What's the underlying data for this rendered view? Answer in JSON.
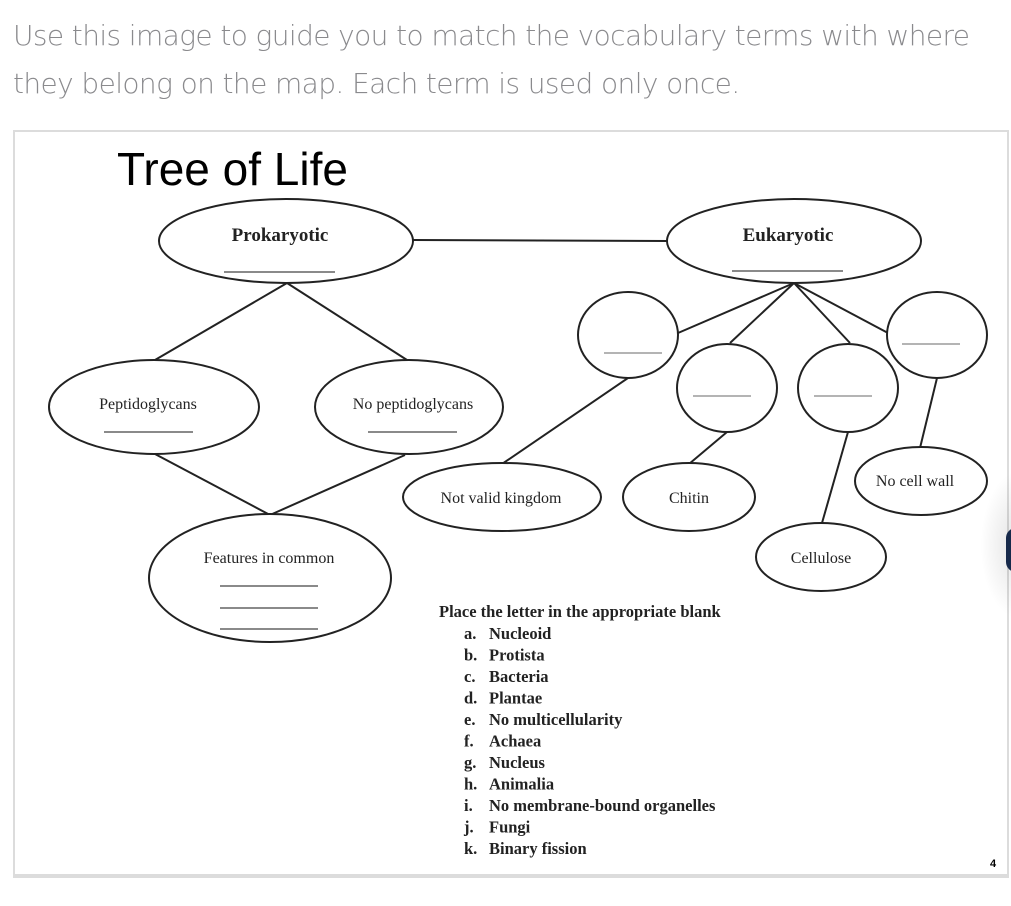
{
  "instructions": "Use this image to guide you to match the vocabulary terms with where they belong on the map. Each term is used only once.",
  "worksheet": {
    "title": "Tree of Life",
    "page_number": "4",
    "nodes": {
      "prokaryotic": {
        "label": "Prokaryotic",
        "blanks": 1
      },
      "eukaryotic": {
        "label": "Eukaryotic",
        "blanks": 1
      },
      "peptidoglycans": {
        "label": "Peptidoglycans",
        "blanks": 1
      },
      "no_peptidoglycans": {
        "label": "No peptidoglycans",
        "blanks": 1
      },
      "features_in_common": {
        "label": "Features in common",
        "blanks": 3
      },
      "eukaryote_kingdom_1": {
        "label": "",
        "blanks": 1
      },
      "eukaryote_kingdom_2": {
        "label": "",
        "blanks": 1
      },
      "eukaryote_kingdom_3": {
        "label": "",
        "blanks": 1
      },
      "eukaryote_kingdom_4": {
        "label": "",
        "blanks": 1
      },
      "not_valid_kingdom": {
        "label": "Not valid kingdom"
      },
      "chitin": {
        "label": "Chitin"
      },
      "cellulose": {
        "label": "Cellulose"
      },
      "no_cell_wall": {
        "label": "No cell wall"
      }
    },
    "word_bank": {
      "heading": "Place the letter in the appropriate blank",
      "items": [
        {
          "letter": "a.",
          "term": "Nucleoid"
        },
        {
          "letter": "b.",
          "term": "Protista"
        },
        {
          "letter": "c.",
          "term": "Bacteria"
        },
        {
          "letter": "d.",
          "term": "Plantae"
        },
        {
          "letter": "e.",
          "term": "No multicellularity"
        },
        {
          "letter": "f.",
          "term": "Achaea"
        },
        {
          "letter": "g.",
          "term": "Nucleus"
        },
        {
          "letter": "h.",
          "term": "Animalia"
        },
        {
          "letter": "i.",
          "term": "No membrane-bound organelles"
        },
        {
          "letter": "j.",
          "term": "Fungi"
        },
        {
          "letter": "k.",
          "term": "Binary fission"
        }
      ]
    }
  }
}
